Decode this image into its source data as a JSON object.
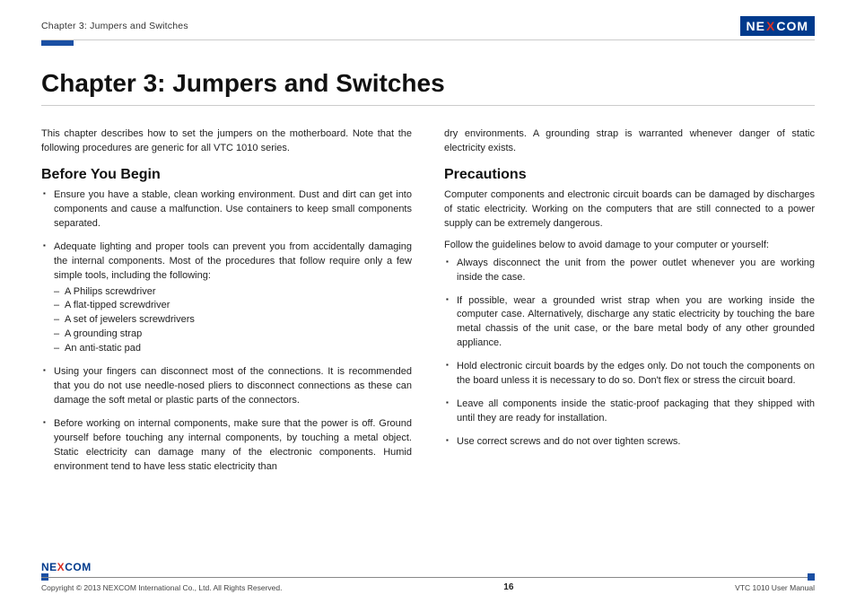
{
  "header": {
    "breadcrumb": "Chapter 3: Jumpers and Switches",
    "logo_parts": {
      "a": "NE",
      "x": "X",
      "b": "COM"
    }
  },
  "title": "Chapter 3: Jumpers and Switches",
  "intro": "This chapter describes how to set the jumpers on the motherboard. Note that the following procedures are generic for all VTC 1010 series.",
  "before": {
    "heading": "Before You Begin",
    "items": {
      "b1": "Ensure you have a stable, clean working environment. Dust and dirt can get into components and cause a malfunction. Use containers to keep small components separated.",
      "b2": "Adequate lighting and proper tools can prevent you from accidentally damaging the internal components. Most of the procedures that follow require only a few simple tools, including the following:",
      "tools": {
        "t1": "A Philips screwdriver",
        "t2": "A flat-tipped screwdriver",
        "t3": "A set of jewelers screwdrivers",
        "t4": "A grounding strap",
        "t5": "An anti-static pad"
      },
      "b3": "Using your fingers can disconnect most of the connections. It is recommended that you do not use needle-nosed pliers to disconnect connections as these can damage the soft metal or plastic parts of the connectors.",
      "b4": "Before working on internal components, make sure that the power is off. Ground yourself before touching any internal components, by touching a metal object. Static electricity can damage many of the electronic components. Humid environment tend to have less static electricity than"
    }
  },
  "right_top": "dry environments. A grounding strap is warranted whenever danger of static electricity exists.",
  "precautions": {
    "heading": "Precautions",
    "p1": "Computer components and electronic circuit boards can be damaged by discharges of static electricity. Working on the computers that are still connected to a power supply can be extremely dangerous.",
    "p2": "Follow the guidelines below to avoid damage to your computer or yourself:",
    "items": {
      "c1": "Always disconnect the unit from the power outlet whenever you are working inside the case.",
      "c2": "If possible, wear a grounded wrist strap when you are working inside the computer case. Alternatively, discharge any static electricity by touching the bare metal chassis of the unit case, or the bare metal body of any other grounded appliance.",
      "c3": "Hold electronic circuit boards by the edges only. Do not touch the components on the board unless it is necessary to do so. Don't flex or stress the circuit board.",
      "c4": "Leave all components inside the static-proof packaging that they shipped with until they are ready for installation.",
      "c5": "Use correct screws and do not over tighten screws."
    }
  },
  "footer": {
    "logo_parts": {
      "a": "NE",
      "x": "X",
      "b": "COM"
    },
    "copyright": "Copyright © 2013 NEXCOM International Co., Ltd. All Rights Reserved.",
    "page": "16",
    "manual": "VTC 1010 User Manual"
  }
}
